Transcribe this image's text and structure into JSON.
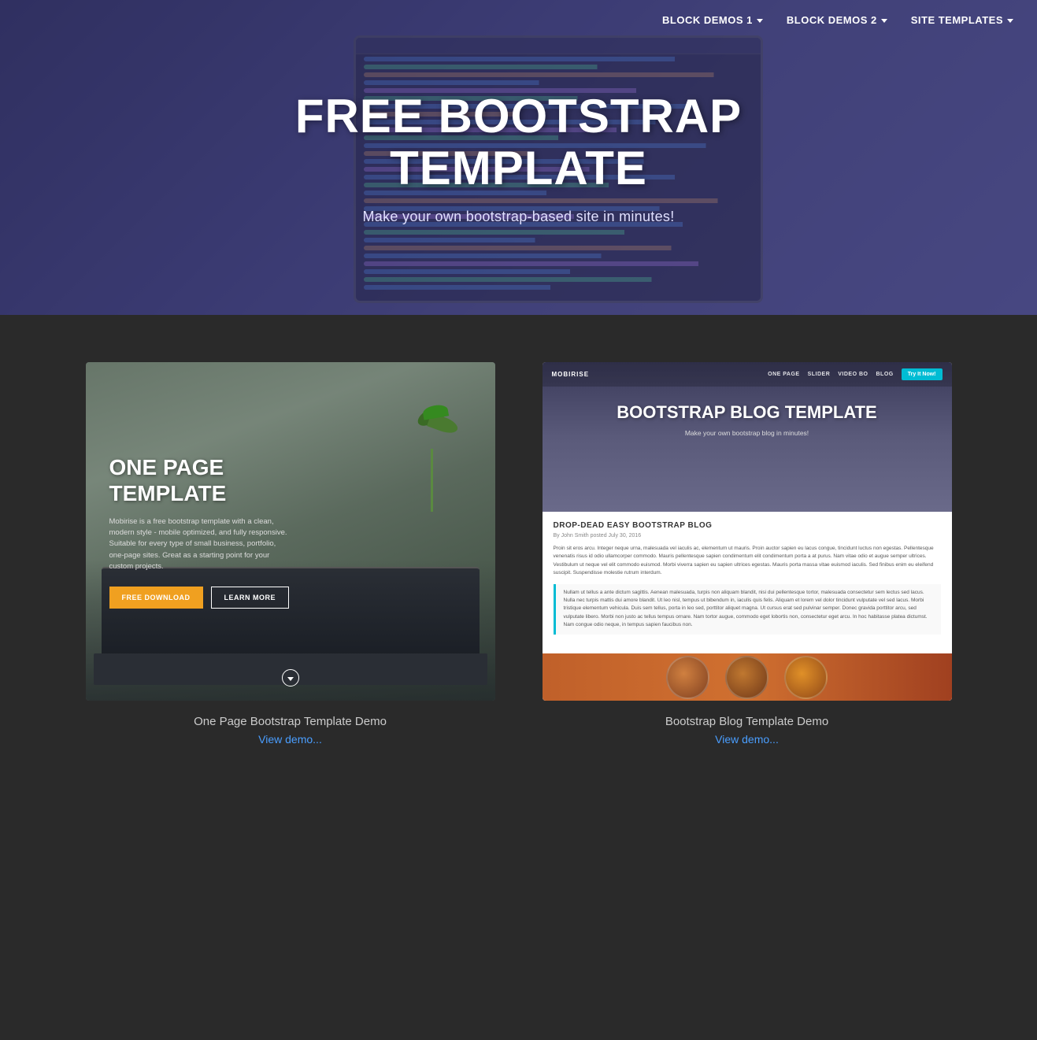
{
  "nav": {
    "items": [
      {
        "label": "BLOCK DEMOS 1",
        "has_caret": true
      },
      {
        "label": "BLOCK DEMOS 2",
        "has_caret": true
      },
      {
        "label": "SITE TEMPLATES",
        "has_caret": true
      }
    ]
  },
  "hero": {
    "title": "FREE BOOTSTRAP TEMPLATE",
    "subtitle": "Make your own bootstrap-based site in minutes!"
  },
  "templates": [
    {
      "id": "one-page",
      "preview_title": "ONE PAGE TEMPLATE",
      "preview_desc": "Mobirise is a free bootstrap template with a clean, modern style - mobile optimized, and fully responsive. Suitable for every type of small business, portfolio, one-page sites. Great as a starting point for your custom projects.",
      "btn_primary": "FREE DOWNLOAD",
      "btn_secondary": "LEARN MORE",
      "card_title": "One Page Bootstrap Template Demo",
      "card_link": "View demo..."
    },
    {
      "id": "blog",
      "blog_brand": "MOBIRISE",
      "blog_nav": [
        "ONE PAGE",
        "SLIDER",
        "VIDEO BO",
        "BLOG"
      ],
      "blog_try_btn": "Try It Now!",
      "preview_title": "BOOTSTRAP BLOG TEMPLATE",
      "preview_subtitle": "Make your own bootstrap blog in minutes!",
      "blog_post_title": "DROP-DEAD EASY BOOTSTRAP BLOG",
      "blog_post_byline": "By John Smith posted July 30, 2016",
      "blog_post_text": "Proin sit eros arcu. Integer neque urna, malesuada vel iaculis ac, elementum ut mauris. Proin auctor sapien eu lacus congue, tincidunt luctus non egestas. Pellentesque venenatis risus id odio ullamcorper commodo. Mauris pellentesque sapien condimentum elit condimentum porta a at purus. Nam vitae odio et augue semper ultrices. Vestibulum ut neque vel elit commodo euismod. Morbi viverra sapien eu sapien ultrices egestas. Mauris porta massa vitae euismod iaculis. Sed finibus enim eu eleifend suscipit. Suspendisse molestie rutrum interdum.",
      "blog_quote": "Nullam ut tellus a ante dictum sagittis. Aenean malesuada, turpis non aliquam blandit, nisi dui pellentesque tortor, malesuada consectetur sem lectus sed lacus. Nulla nec turpis mattis dui amore blandit. Ut leo nisl, tempus ut bibendum in, iaculis quis felis. Aliquam et lorem vel dolor tincidunt vulputate vel sed lacus. Morbi tristique elementum vehicula. Duis sem tellus, porta in leo sed, porttitor aliquet magna. Ut cursus erat sed pulvinar semper. Donec gravida porttitor arcu, sed vulputate libero. Morbi non justo ac tellus tempus ornare. Nam tortor augue, commodo eget lobortis non, consectetur eget arcu. In hoc habitasse platea dictumst. Nam congue odio neque, in tempus sapien faucibus non.",
      "card_title": "Bootstrap Blog Template Demo",
      "card_link": "View demo..."
    }
  ]
}
